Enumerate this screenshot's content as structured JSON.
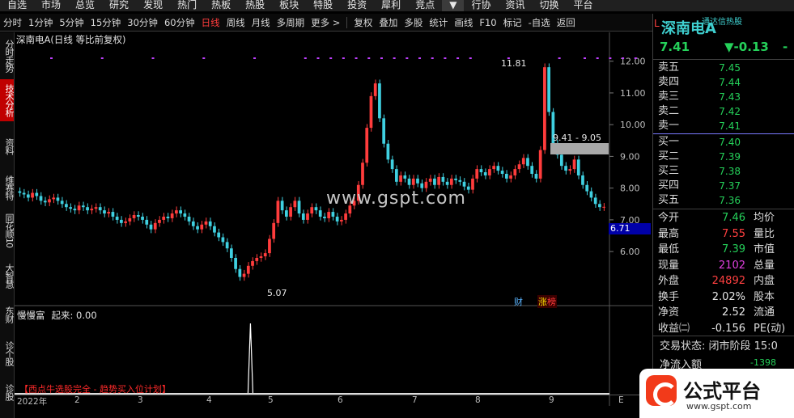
{
  "top_menu": [
    "自选",
    "市场",
    "总览",
    "研究",
    "发现",
    "热门",
    "热板",
    "热股",
    "板块",
    "特股",
    "投资",
    "犀利",
    "竞点",
    "▼",
    "行协",
    "资讯",
    "切换",
    "平台"
  ],
  "toolbar": {
    "periods": [
      "分时",
      "1分钟",
      "5分钟",
      "15分钟",
      "30分钟",
      "60分钟",
      "日线",
      "周线",
      "月线",
      "多周期",
      "更多 >"
    ],
    "selected": "日线",
    "tools": [
      "复权",
      "叠加",
      "多股",
      "统计",
      "画线",
      "F10",
      "标记",
      "-自选",
      "返回"
    ]
  },
  "left_tabs": [
    "分时走势",
    "技术分析",
    "资料",
    "维赛特",
    "同花顺10",
    "大智慧",
    "东财",
    "诊个股",
    "诊股"
  ],
  "chart": {
    "title": "深南电A(日线 等比前复权)",
    "indicator_name": "慢慢富",
    "indicator_value": "起来: 0.00",
    "banner": "【西点牛选股完全 - 趋势买入位计划】",
    "watermark": "www.gspt.com",
    "y_ticks": [
      "12.00",
      "11.00",
      "10.00",
      "9.00",
      "8.00",
      "7.00",
      "6.00"
    ],
    "annotations": {
      "high": "11.81",
      "low": "5.07",
      "range": "9.41 - 9.05",
      "current": "6.71"
    },
    "tag_cai": "财",
    "tag_zt": "涨",
    "tag_zt_red": "榜",
    "timeline": [
      "2022年",
      "2",
      "3",
      "4",
      "5",
      "6",
      "7",
      "8",
      "9",
      "E"
    ]
  },
  "chart_data": {
    "type": "candlestick",
    "title": "深南电A(日线 等比前复权)",
    "ylim": [
      4.5,
      12.4
    ],
    "y_ticks": [
      6,
      7,
      8,
      9,
      10,
      11,
      12
    ],
    "high": 11.81,
    "low": 5.07,
    "closes": [
      7.85,
      7.8,
      7.7,
      7.85,
      7.75,
      7.6,
      7.55,
      7.65,
      7.7,
      7.6,
      7.5,
      7.4,
      7.35,
      7.3,
      7.45,
      7.4,
      7.3,
      7.35,
      7.4,
      7.3,
      7.2,
      7.25,
      7.1,
      7.0,
      6.9,
      6.95,
      7.05,
      7.15,
      7.1,
      7.0,
      6.85,
      6.7,
      6.9,
      7.0,
      7.1,
      7.05,
      7.2,
      7.3,
      7.2,
      7.1,
      6.95,
      6.8,
      6.7,
      6.85,
      6.95,
      6.8,
      6.6,
      6.45,
      6.3,
      6.1,
      5.8,
      5.45,
      5.2,
      5.3,
      5.55,
      5.7,
      5.8,
      5.85,
      5.95,
      6.4,
      6.9,
      7.6,
      7.3,
      7.1,
      7.4,
      7.6,
      7.2,
      7.0,
      7.2,
      7.4,
      7.3,
      7.1,
      7.05,
      7.25,
      7.1,
      6.95,
      7.0,
      7.2,
      7.45,
      7.6,
      8.1,
      8.8,
      9.9,
      10.9,
      11.3,
      10.2,
      9.4,
      8.9,
      8.6,
      8.2,
      8.4,
      8.3,
      8.1,
      8.3,
      8.15,
      8.0,
      8.2,
      8.3,
      8.1,
      8.35,
      8.2,
      8.1,
      8.3,
      8.25,
      8.2,
      8.05,
      7.95,
      8.3,
      8.6,
      8.5,
      8.4,
      8.6,
      8.7,
      8.55,
      8.45,
      8.3,
      8.4,
      8.6,
      8.75,
      8.95,
      8.7,
      8.45,
      8.3,
      9.2,
      11.81,
      10.4,
      9.4,
      9.05,
      8.7,
      8.55,
      8.6,
      8.9,
      8.4,
      8.1,
      7.9,
      7.7,
      7.5,
      7.4,
      7.41
    ]
  },
  "indicator_data": {
    "name": "慢慢富",
    "spike_index": 54,
    "spike_value": 1
  },
  "quote": {
    "name": "深南电A",
    "source": "通达信热股",
    "market_flag": "L",
    "price": "7.41",
    "change": "▼-0.13",
    "change_pct": "-",
    "sells": [
      [
        "卖五",
        "7.45"
      ],
      [
        "卖四",
        "7.44"
      ],
      [
        "卖三",
        "7.43"
      ],
      [
        "卖二",
        "7.42"
      ],
      [
        "卖一",
        "7.41"
      ]
    ],
    "buys": [
      [
        "买一",
        "7.40"
      ],
      [
        "买二",
        "7.39"
      ],
      [
        "买三",
        "7.38"
      ],
      [
        "买四",
        "7.37"
      ],
      [
        "买五",
        "7.36"
      ]
    ],
    "stats": [
      {
        "k": "今开",
        "v": "7.46",
        "c": "g",
        "k2": "均价"
      },
      {
        "k": "最高",
        "v": "7.55",
        "c": "r",
        "k2": "量比"
      },
      {
        "k": "最低",
        "v": "7.39",
        "c": "g",
        "k2": "市值"
      },
      {
        "k": "现量",
        "v": "2102",
        "c": "m",
        "k2": "总量"
      },
      {
        "k": "外盘",
        "v": "24892",
        "c": "r",
        "k2": "内盘"
      },
      {
        "k": "换手",
        "v": "2.02%",
        "c": "w",
        "k2": "股本"
      },
      {
        "k": "净资",
        "v": "2.52",
        "c": "w",
        "k2": "流通"
      },
      {
        "k": "收益㈡",
        "v": "-0.156",
        "c": "w",
        "k2": "PE(动)"
      }
    ],
    "trade_state": "交易状态: 闭市阶段 15:0",
    "net_inflow_label": "净流入额",
    "net_inflow_value": "-1398"
  },
  "logo": {
    "text": "公式平台",
    "url": "www.gspt.com"
  },
  "colors": {
    "up": "#ff3c3c",
    "down": "#3fd0e0",
    "green": "#25d15a"
  }
}
